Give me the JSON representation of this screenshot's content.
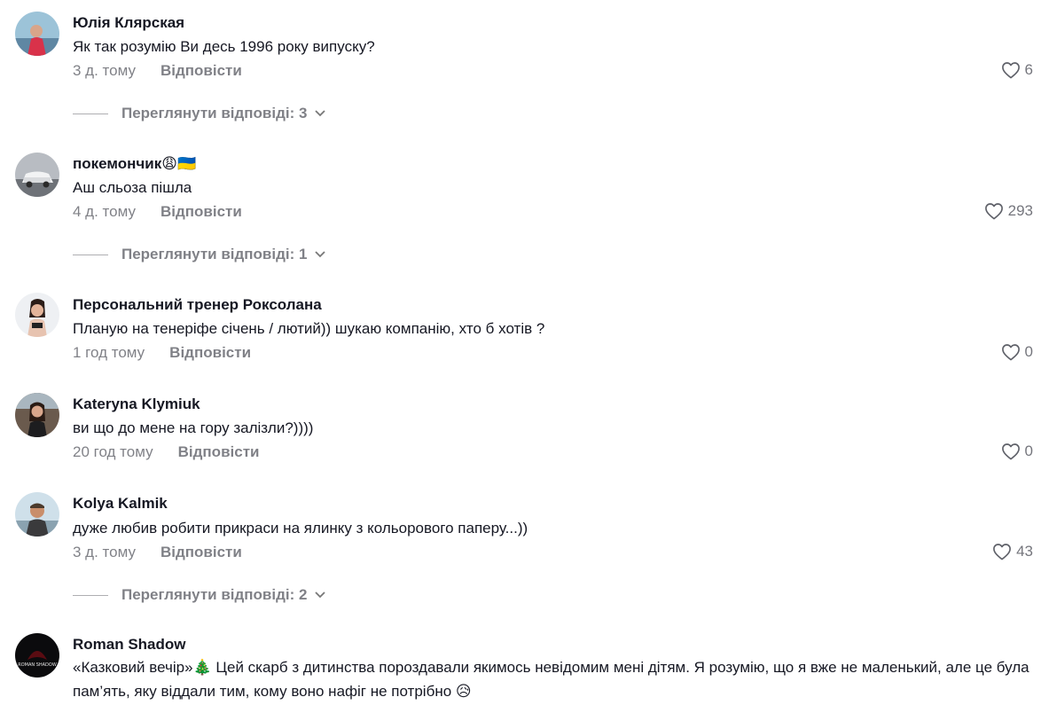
{
  "comments": [
    {
      "author": "Юлія Клярская",
      "text": "Як так розумію Ви десь 1996 року випуску?",
      "time": "3 д. тому",
      "reply_label": "Відповісти",
      "likes": "6",
      "view_replies": "Переглянути відповіді: 3"
    },
    {
      "author": "покемончик😩🇺🇦",
      "text": "Аш сльоза пішла",
      "time": "4 д. тому",
      "reply_label": "Відповісти",
      "likes": "293",
      "view_replies": "Переглянути відповіді: 1"
    },
    {
      "author": "Персональний тренер Роксолана",
      "text": "Планую на тенеріфе січень / лютий)) шукаю компанію, хто б хотів ?",
      "time": "1 год тому",
      "reply_label": "Відповісти",
      "likes": "0"
    },
    {
      "author": "Kateryna Klymiuk",
      "text": "ви що до мене на гору залізли?))))",
      "time": "20 год тому",
      "reply_label": "Відповісти",
      "likes": "0"
    },
    {
      "author": "Kolya Kalmik",
      "text": "дуже любив робити прикраси на ялинку з кольорового паперу...))",
      "time": "3 д. тому",
      "reply_label": "Відповісти",
      "likes": "43",
      "view_replies": "Переглянути відповіді: 2"
    },
    {
      "author": "Roman Shadow",
      "text": "«Казковий вечір»🎄 Цей скарб з дитинства пороздавали якимось невідомим мені дітям. Я розумію, що я вже не маленький, але це була пам’ять, яку віддали тим, кому воно нафіг не потрібно 😥",
      "avatar_text": "ROMAN SHADOW"
    }
  ],
  "colors": {
    "text": "#161823",
    "muted": "#8a8b91"
  },
  "icons": {
    "like": "heart-outline-icon",
    "expand": "chevron-down-icon"
  }
}
